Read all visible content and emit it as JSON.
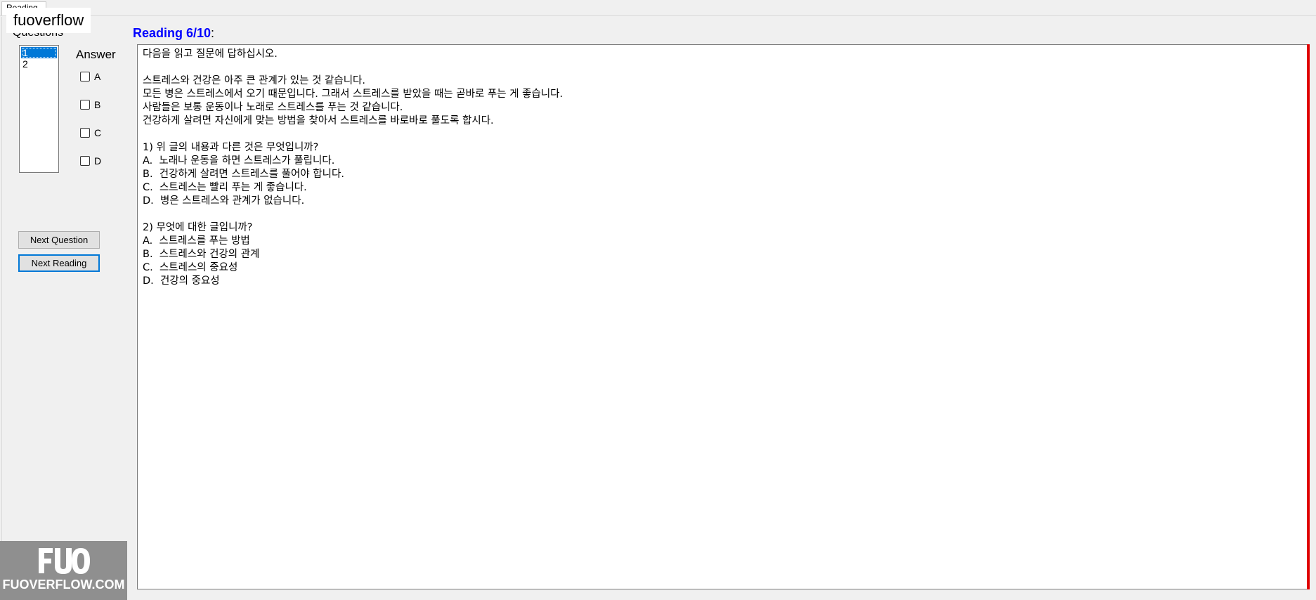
{
  "window": {
    "tab_label": "Reading",
    "brand_label": "fuoverflow"
  },
  "questions": {
    "label": "Questions",
    "items": [
      "1",
      "2"
    ],
    "selected": "1"
  },
  "answer": {
    "label": "Answer",
    "options": [
      "A",
      "B",
      "C",
      "D"
    ]
  },
  "buttons": {
    "next_question": "Next Question",
    "next_reading": "Next Reading"
  },
  "reading": {
    "title": "Reading 6/10",
    "title_suffix": ":",
    "text": "다음을 읽고 질문에 답하십시오.\n\n스트레스와 건강은 아주 큰 관계가 있는 것 같습니다.\n모든 병은 스트레스에서 오기 때문입니다. 그래서 스트레스를 받았을 때는 곧바로 푸는 게 좋습니다.\n사람들은 보통 운동이나 노래로 스트레스를 푸는 것 같습니다.\n건강하게 살려면 자신에게 맞는 방법을 찾아서 스트레스를 바로바로 풀도록 합시다.\n\n1) 위 글의 내용과 다른 것은 무엇입니까?\nA.  노래나 운동을 하면 스트레스가 풀립니다.\nB.  건강하게 살려면 스트레스를 풀어야 합니다.\nC.  스트레스는 빨리 푸는 게 좋습니다.\nD.  병은 스트레스와 관계가 없습니다.\n\n2) 무엇에 대한 글입니까?\nA.  스트레스를 푸는 방법\nB.  스트레스와 건강의 관계\nC.  스트레스의 중요성\nD.  건강의 중요성"
  },
  "watermark": {
    "logo": "FUO",
    "url": "FUOVERFLOW.COM"
  },
  "colors": {
    "accent": "#0078d7",
    "title": "#0000ff",
    "red_bar": "#e00000"
  }
}
